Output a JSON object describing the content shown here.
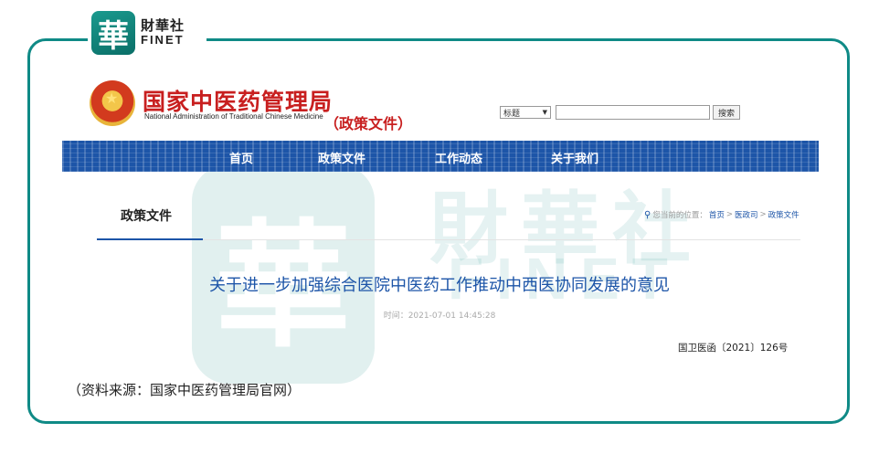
{
  "finet": {
    "mark_char": "華",
    "name_cn": "財華社",
    "name_en": "FINET"
  },
  "site": {
    "title_cn": "国家中医药管理局",
    "title_en": "National Administration of Traditional Chinese Medicine",
    "section": "（政策文件）"
  },
  "search": {
    "selected": "标题",
    "button": "搜索"
  },
  "nav": {
    "items": [
      "首页",
      "政策文件",
      "工作动态",
      "关于我们"
    ]
  },
  "breadcrumb": {
    "tab": "政策文件",
    "prefix": "您当前的位置：",
    "path": [
      "首页",
      "医政司",
      "政策文件"
    ],
    "sep": ">"
  },
  "article": {
    "title": "关于进一步加强综合医院中医药工作推动中西医协同发展的意见",
    "time": "时间：2021-07-01 14:45:28",
    "doc_number": "国卫医函〔2021〕126号"
  },
  "source_note": "（资料来源：国家中医药管理局官网）",
  "colors": {
    "frame": "#0f8a86",
    "nav": "#1d55a8",
    "title_red": "#c81f1f"
  }
}
